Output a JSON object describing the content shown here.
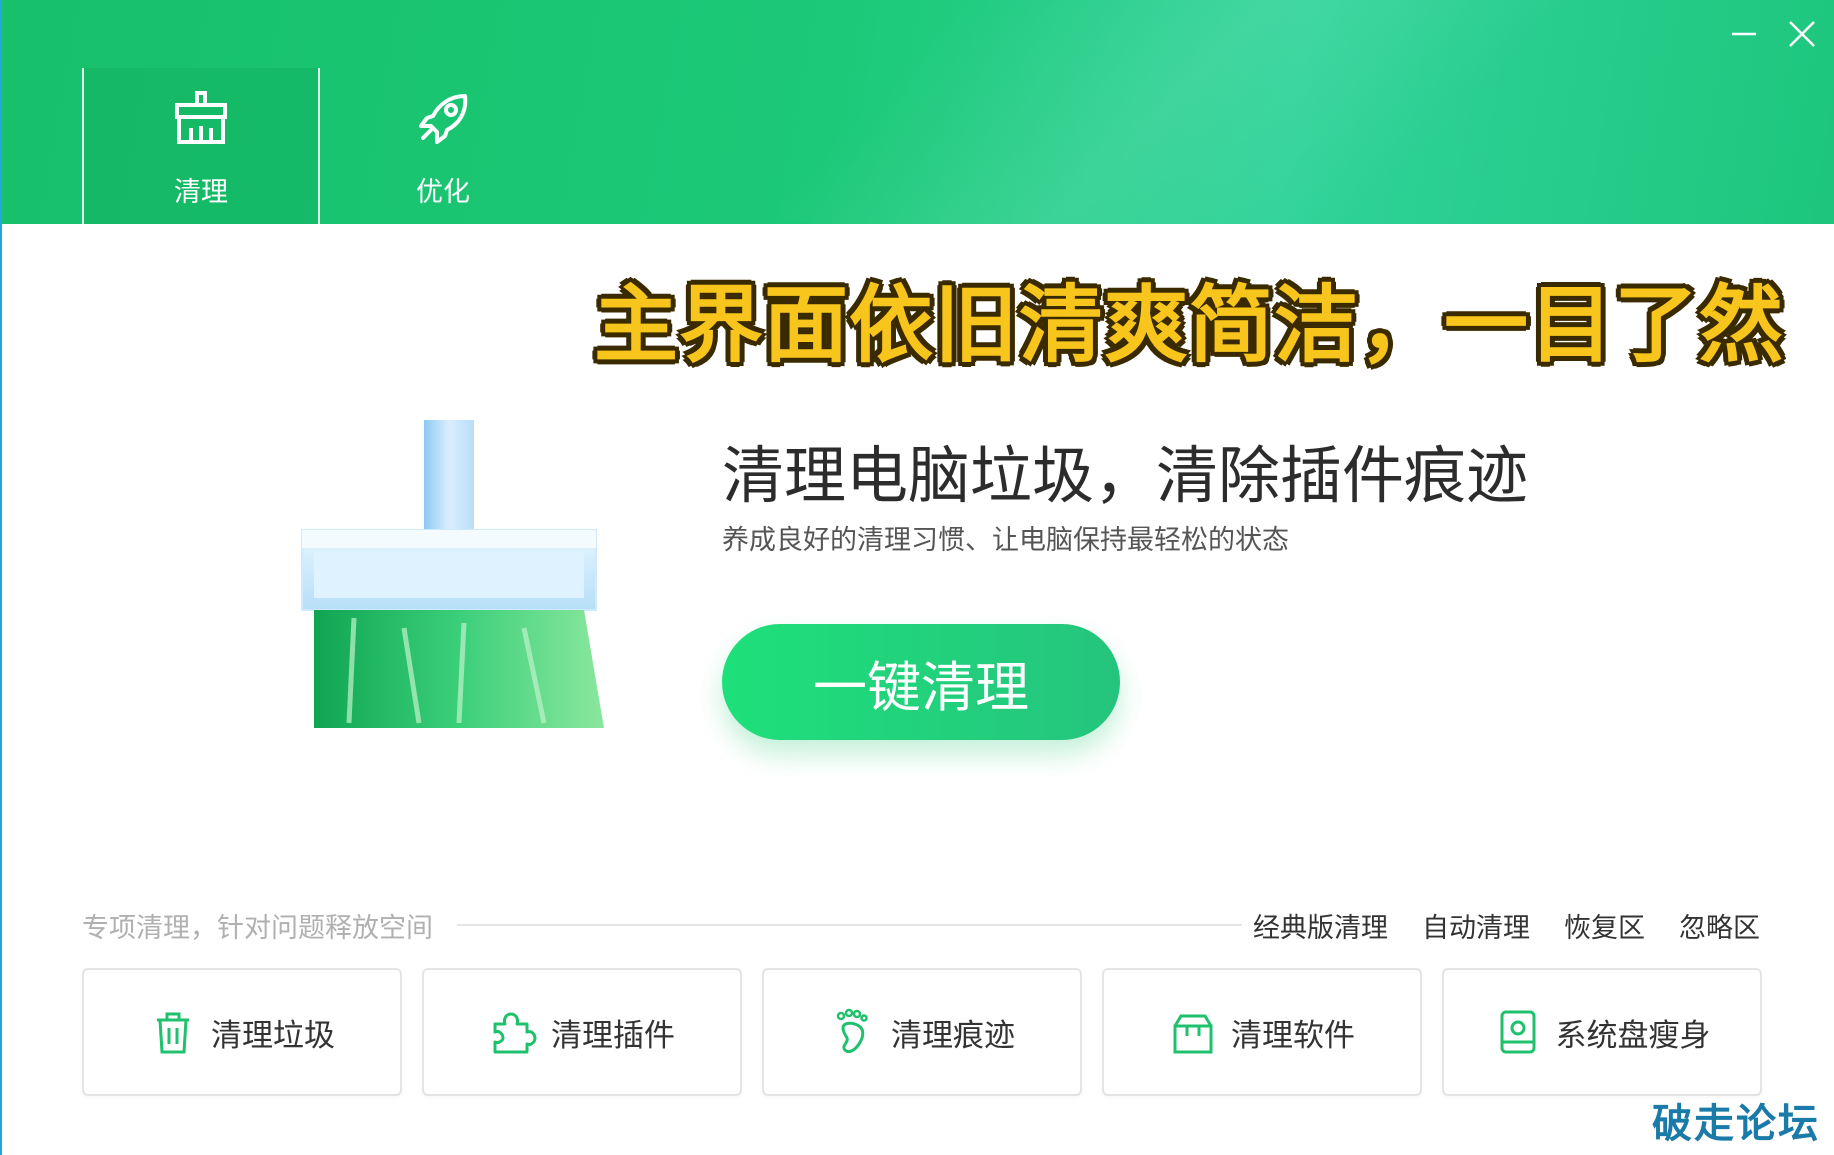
{
  "header": {
    "tabs": [
      {
        "label": "清理",
        "icon": "broom-icon",
        "active": true
      },
      {
        "label": "优化",
        "icon": "rocket-icon",
        "active": false
      }
    ],
    "controls": {
      "minimize_icon": "minimize-icon",
      "close_icon": "close-icon"
    }
  },
  "banner": {
    "text": "主界面依旧清爽简洁，一目了然"
  },
  "main": {
    "title": "清理电脑垃圾，清除插件痕迹",
    "subtitle": "养成良好的清理习惯、让电脑保持最轻松的状态",
    "cta_label": "一键清理"
  },
  "special": {
    "label": "专项清理，针对问题释放空间",
    "links": [
      "经典版清理",
      "自动清理",
      "恢复区",
      "忽略区"
    ],
    "cards": [
      {
        "label": "清理垃圾",
        "icon": "trash-icon"
      },
      {
        "label": "清理插件",
        "icon": "puzzle-icon"
      },
      {
        "label": "清理痕迹",
        "icon": "footprint-icon"
      },
      {
        "label": "清理软件",
        "icon": "software-box-icon"
      },
      {
        "label": "系统盘瘦身",
        "icon": "disk-icon"
      }
    ]
  },
  "watermark": "破走论坛",
  "colors": {
    "brand_green": "#1cc978",
    "banner_yellow": "#f8c51c",
    "watermark_blue": "#1a7aa8"
  }
}
